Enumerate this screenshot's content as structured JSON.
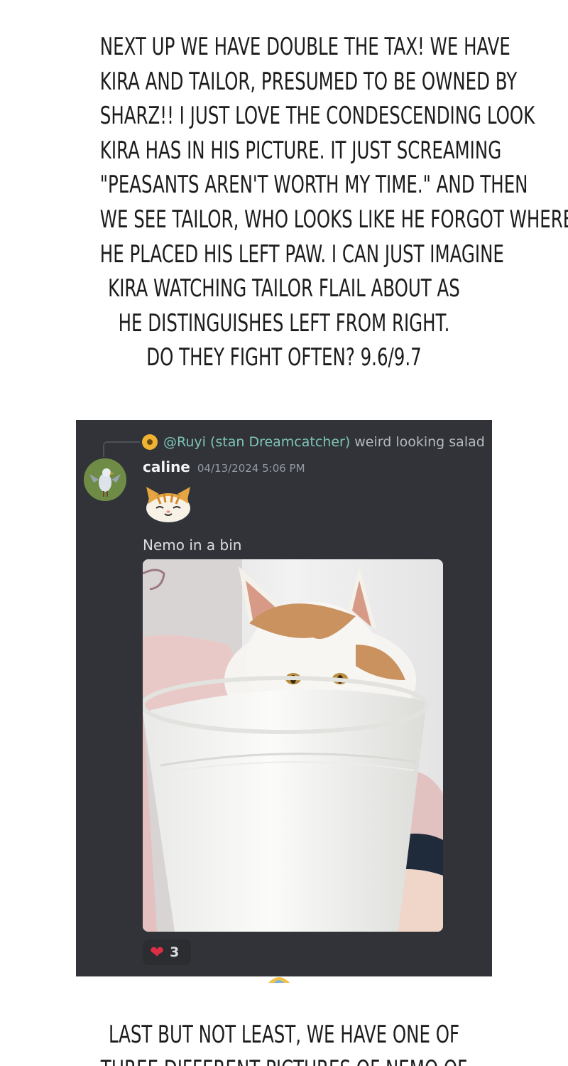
{
  "caption_top": {
    "lines": [
      "NEXT UP WE HAVE DOUBLE THE TAX! WE HAVE",
      "KIRA AND TAILOR, PRESUMED TO BE OWNED BY",
      "SHARZ!! I JUST LOVE THE CONDESCENDING LOOK",
      "KIRA HAS IN HIS PICTURE. IT JUST SCREAMING",
      "\"PEASANTS AREN'T WORTH MY TIME.\" AND THEN",
      "WE SEE TAILOR, WHO LOOKS LIKE HE FORGOT WHERE",
      "HE PLACED HIS LEFT PAW. I CAN JUST IMAGINE",
      "KIRA WATCHING TAILOR FLAIL ABOUT AS",
      "HE DISTINGUISHES LEFT FROM RIGHT.",
      "DO THEY FIGHT OFTEN? 9.6/9.7"
    ]
  },
  "discord": {
    "reply": {
      "mention": "@Ruyi (stan Dreamcatcher)",
      "text": "weird looking salad",
      "avatar_color": "#f0b232"
    },
    "message": {
      "username": "caline",
      "timestamp": "04/13/2024 5:06 PM",
      "text": "Nemo in a bin",
      "photo_icon": "cat-in-bin-photo"
    },
    "reaction": {
      "emoji": "❤",
      "count": "3",
      "color": "#dd2e44"
    },
    "colors": {
      "background": "#313338",
      "username": "#f2f3f5",
      "mention": "#7ec5b8",
      "muted": "#949ba4"
    }
  },
  "caption_bottom": {
    "lines": [
      "LAST BUT NOT LEAST, WE HAVE ONE OF",
      "THREE DIFFERENT PICTURES OF NEMO OF"
    ]
  }
}
